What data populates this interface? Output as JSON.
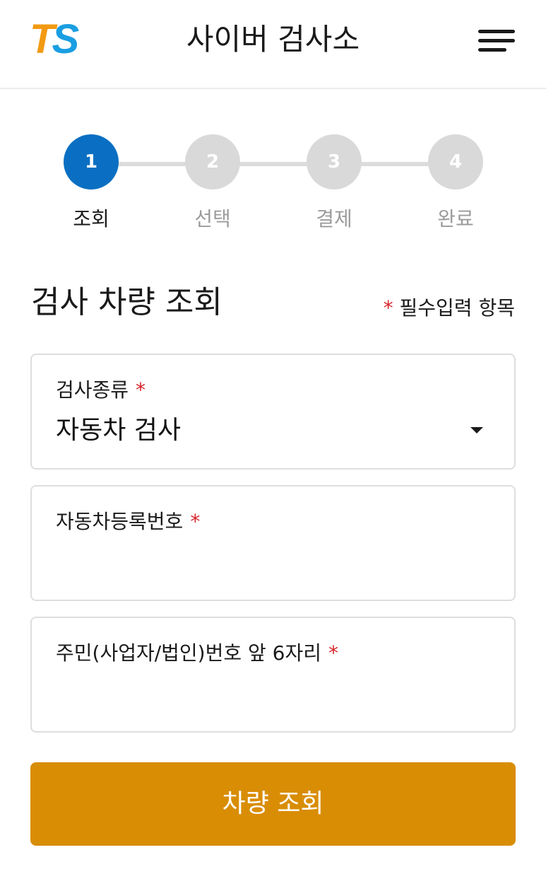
{
  "header": {
    "logo_text_t": "T",
    "logo_text_s": "S",
    "title": "사이버 검사소"
  },
  "steps": [
    {
      "number": "1",
      "label": "조회",
      "active": true
    },
    {
      "number": "2",
      "label": "선택",
      "active": false
    },
    {
      "number": "3",
      "label": "결제",
      "active": false
    },
    {
      "number": "4",
      "label": "완료",
      "active": false
    }
  ],
  "section": {
    "title": "검사 차량 조회",
    "required_mark": "*",
    "required_note": "필수입력 항목"
  },
  "form": {
    "inspection_type": {
      "label": "검사종류",
      "required": "*",
      "value": "자동차 검사"
    },
    "registration_number": {
      "label": "자동차등록번호",
      "required": "*",
      "value": ""
    },
    "resident_number": {
      "label": "주민(사업자/법인)번호 앞 6자리",
      "required": "*",
      "value": ""
    }
  },
  "submit": {
    "label": "차량 조회"
  },
  "colors": {
    "accent": "#0a6fc2",
    "button": "#d98d05",
    "required": "#d8262b",
    "inactive_step": "#d9d9d9"
  }
}
